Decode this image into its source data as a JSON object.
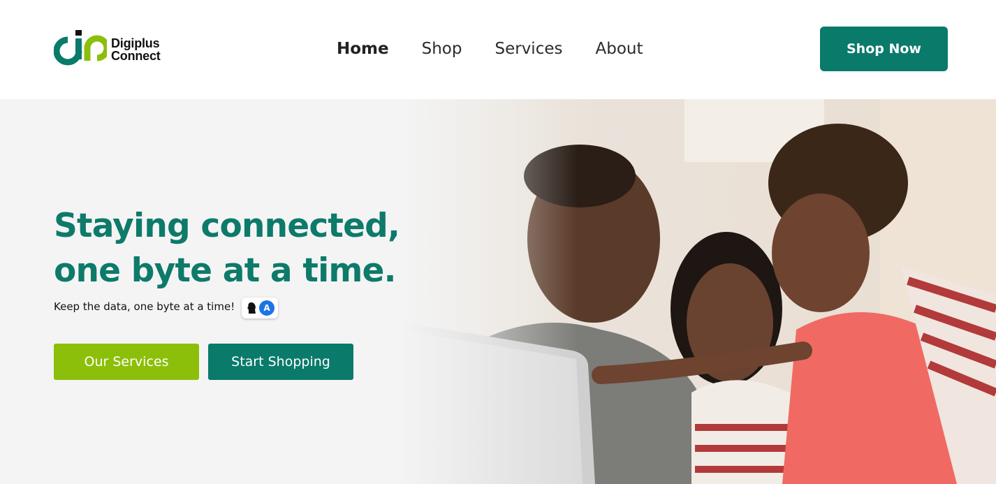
{
  "brand": {
    "name_line1": "Digiplus",
    "name_line2": "Connect",
    "colors": {
      "primary": "#0a7a6b",
      "accent": "#8cbf0a",
      "dark": "#111111"
    }
  },
  "nav": {
    "items": [
      {
        "label": "Home",
        "active": true
      },
      {
        "label": "Shop",
        "active": false
      },
      {
        "label": "Services",
        "active": false
      },
      {
        "label": "About",
        "active": false
      }
    ]
  },
  "header": {
    "cta_label": "Shop Now"
  },
  "hero": {
    "title_line1": "Staying connected,",
    "title_line2": "one byte at a time.",
    "subtitle": "Keep the data, one byte at a time!",
    "badge_letter": "A",
    "primary_button": "Our Services",
    "secondary_button": "Start Shopping",
    "image": "family-with-laptop-photo"
  }
}
